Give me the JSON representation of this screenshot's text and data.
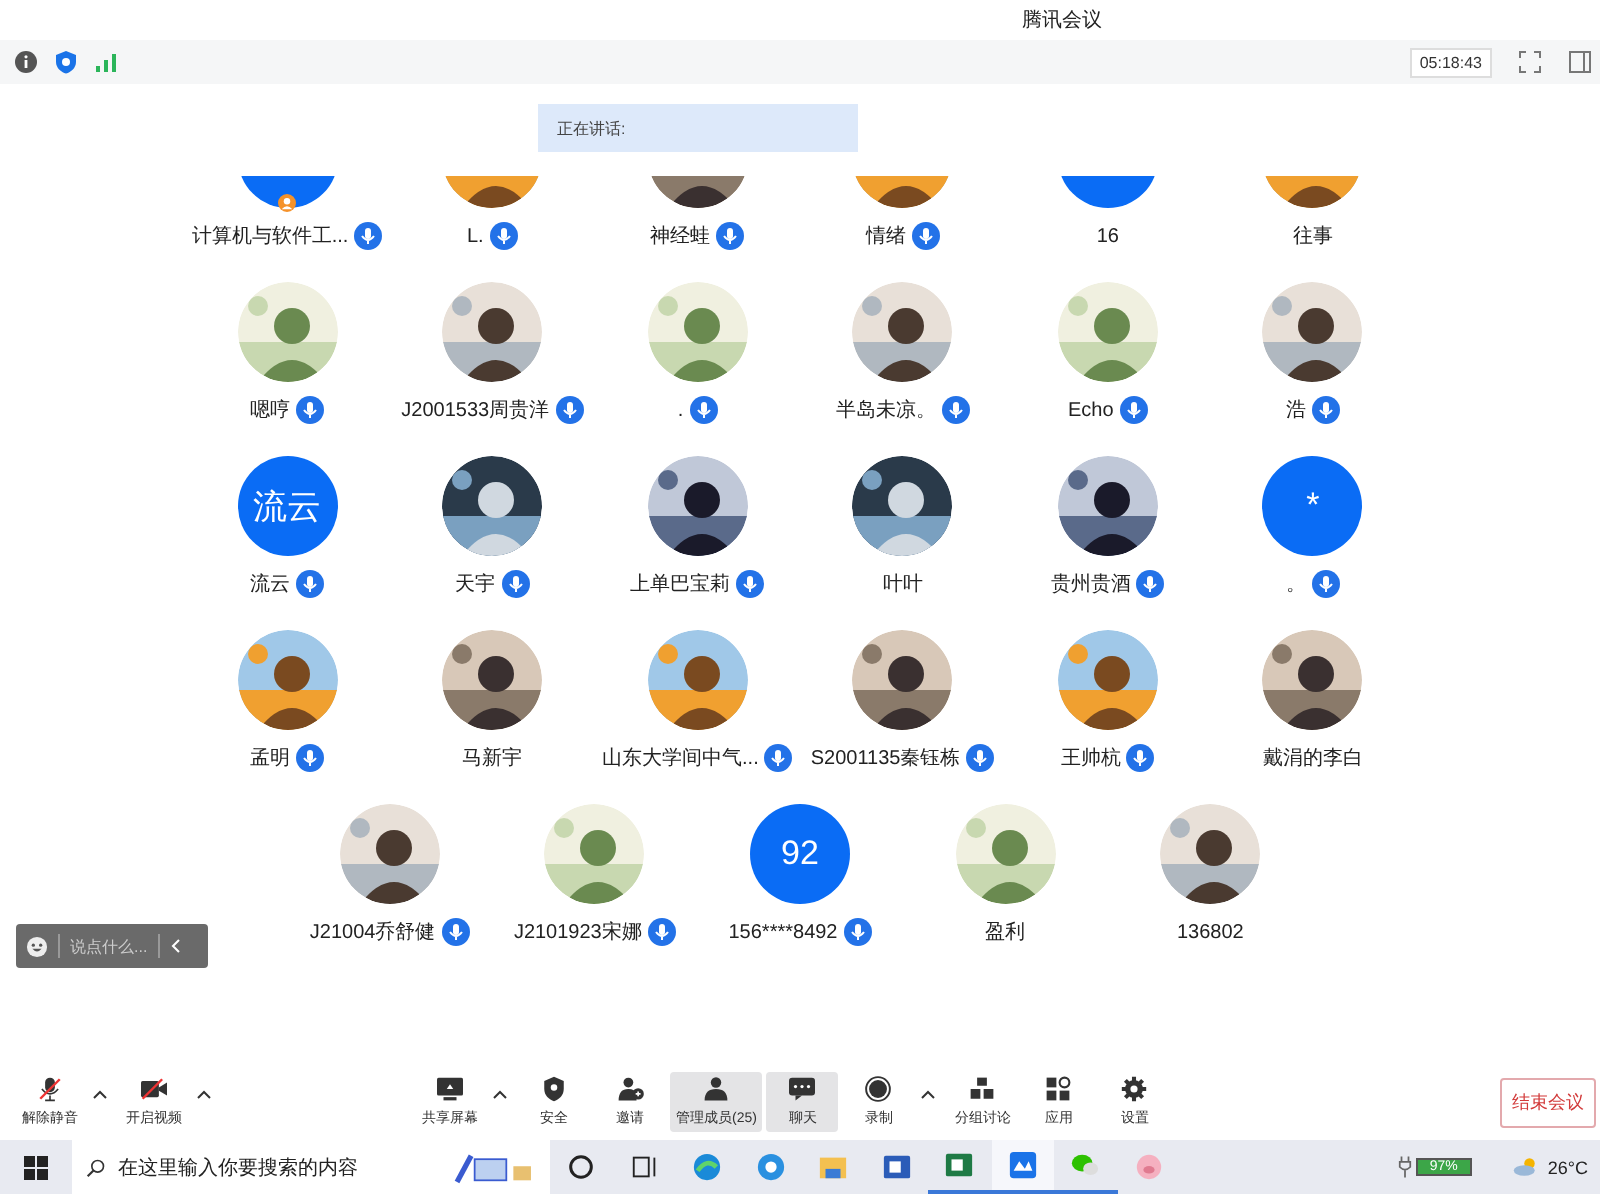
{
  "window": {
    "title": "腾讯会议"
  },
  "toolbar": {
    "timer": "05:18:43"
  },
  "speaking": {
    "label": "正在讲话:"
  },
  "participant_rows": [
    {
      "cut_off": true,
      "participants": [
        {
          "name": "计算机与软件工...",
          "avatar": {
            "kind": "blank"
          },
          "mic": true,
          "host": true
        },
        {
          "name": "L.",
          "mic": true,
          "host": false
        },
        {
          "name": "神经蛙",
          "mic": true,
          "host": false
        },
        {
          "name": "情绪",
          "mic": true,
          "host": false
        },
        {
          "name": "16",
          "avatar": {
            "kind": "blank"
          },
          "mic": false,
          "host": false
        },
        {
          "name": "往事",
          "mic": false,
          "host": false
        }
      ]
    },
    {
      "cut_off": false,
      "participants": [
        {
          "name": "嗯哼",
          "mic": true,
          "host": false
        },
        {
          "name": "J2001533周贵洋",
          "mic": true,
          "host": false
        },
        {
          "name": ".",
          "mic": true,
          "host": false
        },
        {
          "name": "半岛未凉。",
          "mic": true,
          "host": false
        },
        {
          "name": "Echo",
          "mic": true,
          "host": false
        },
        {
          "name": "浩",
          "mic": true,
          "host": false
        }
      ]
    },
    {
      "cut_off": false,
      "participants": [
        {
          "name": "流云",
          "avatar": {
            "kind": "text",
            "text": "流云"
          },
          "mic": true,
          "host": false
        },
        {
          "name": "天宇",
          "mic": true,
          "host": false
        },
        {
          "name": "上单巴宝莉",
          "mic": true,
          "host": false
        },
        {
          "name": "叶叶",
          "mic": false,
          "host": false
        },
        {
          "name": "贵州贵酒",
          "mic": true,
          "host": false
        },
        {
          "name": "。",
          "avatar": {
            "kind": "text",
            "text": "*"
          },
          "mic": true,
          "host": false
        }
      ]
    },
    {
      "cut_off": false,
      "participants": [
        {
          "name": "孟明",
          "mic": true,
          "host": false
        },
        {
          "name": "马新宇",
          "mic": false,
          "host": false
        },
        {
          "name": "山东大学间中气...",
          "mic": true,
          "host": false
        },
        {
          "name": "S2001135秦钰栋",
          "mic": true,
          "host": false
        },
        {
          "name": "王帅杭",
          "mic": true,
          "host": false
        },
        {
          "name": "戴涓的李白",
          "mic": false,
          "host": false
        }
      ]
    },
    {
      "cut_off": false,
      "participants": [
        {
          "name": "J21004乔舒健",
          "mic": true,
          "host": false
        },
        {
          "name": "J2101923宋娜",
          "mic": true,
          "host": false
        },
        {
          "name": "156****8492",
          "avatar": {
            "kind": "text",
            "text": "92"
          },
          "mic": true,
          "host": false
        },
        {
          "name": "盈利",
          "mic": false,
          "host": false
        },
        {
          "name": "136802",
          "mic": false,
          "host": false
        }
      ]
    }
  ],
  "chat": {
    "placeholder": "说点什么..."
  },
  "controls": {
    "left": [
      {
        "label": "解除静音",
        "kind": "mic-off",
        "caret": true,
        "selected": false
      },
      {
        "label": "开启视频",
        "kind": "video-off",
        "caret": true,
        "selected": false
      }
    ],
    "center": [
      {
        "label": "共享屏幕",
        "kind": "share",
        "caret": true,
        "selected": false
      },
      {
        "label": "安全",
        "kind": "shield",
        "caret": false,
        "selected": false
      },
      {
        "label": "邀请",
        "kind": "invite",
        "caret": false,
        "selected": false
      },
      {
        "label": "管理成员(25)",
        "kind": "members",
        "caret": false,
        "selected": true
      },
      {
        "label": "聊天",
        "kind": "chat",
        "caret": false,
        "selected": true
      },
      {
        "label": "录制",
        "kind": "record",
        "caret": true,
        "selected": false
      },
      {
        "label": "分组讨论",
        "kind": "breakout",
        "caret": false,
        "selected": false
      },
      {
        "label": "应用",
        "kind": "apps",
        "caret": false,
        "selected": false
      },
      {
        "label": "设置",
        "kind": "settings",
        "caret": false,
        "selected": false
      }
    ],
    "end_button": "结束会议"
  },
  "taskbar": {
    "search_placeholder": "在这里输入你要搜索的内容",
    "apps": [
      {
        "kind": "cortana",
        "running": false,
        "selected": false
      },
      {
        "kind": "taskview",
        "running": false,
        "selected": false
      },
      {
        "kind": "edge",
        "running": false,
        "selected": false
      },
      {
        "kind": "ie",
        "running": false,
        "selected": false
      },
      {
        "kind": "folder",
        "running": false,
        "selected": false
      },
      {
        "kind": "word",
        "running": false,
        "selected": false
      },
      {
        "kind": "excel",
        "running": true,
        "selected": false
      },
      {
        "kind": "meeting",
        "running": true,
        "selected": true
      },
      {
        "kind": "wechat",
        "running": true,
        "selected": false
      },
      {
        "kind": "pig",
        "running": false,
        "selected": false
      }
    ],
    "battery": "97%",
    "weather": "26°C"
  }
}
